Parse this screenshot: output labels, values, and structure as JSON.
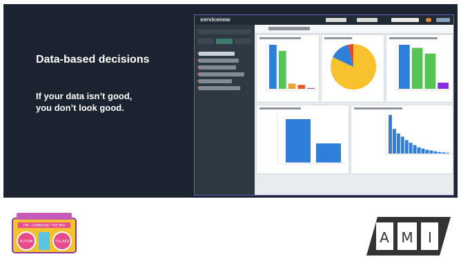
{
  "slide": {
    "headline": "Data-based decisions",
    "subtext_line1": "If your data isn’t good,",
    "subtext_line2": "you don’t look good."
  },
  "screenshot": {
    "brand": "servicenow"
  },
  "charts": {
    "bar1": {
      "values": [
        100,
        86,
        12,
        9,
        2
      ],
      "colors": [
        "#2f7ed8",
        "#55c455",
        "#f0a030",
        "#e6582f",
        "#9b59b6"
      ]
    },
    "pie": {
      "values": [
        82,
        14,
        4
      ],
      "colors": [
        "#f8c12e",
        "#2f7ed8",
        "#e04a33"
      ]
    },
    "bar2": {
      "values": [
        100,
        93,
        80,
        14
      ],
      "colors": [
        "#2f7ed8",
        "#55c455",
        "#55c455",
        "#8a2be2"
      ]
    },
    "bar3": {
      "values": [
        100,
        44
      ],
      "colors": [
        "#2f7ed8",
        "#2f7ed8"
      ]
    },
    "bar4": {
      "values": [
        100,
        64,
        52,
        44,
        35,
        28,
        22,
        16,
        13,
        10,
        8,
        6,
        4,
        3,
        2
      ],
      "colors": [
        "#2f7ed8"
      ]
    }
  },
  "logos": {
    "left_sticker_text_1": "I'M • REMIXING THE MIX",
    "left_sticker_text_2": "AUTOM",
    "left_sticker_text_3": "70s ACE",
    "ami_letters": [
      "A",
      "M",
      "I"
    ]
  }
}
